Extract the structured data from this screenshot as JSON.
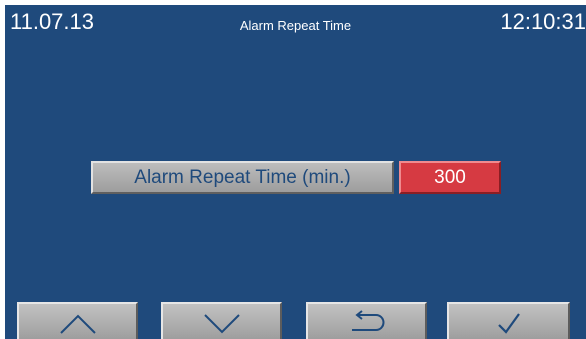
{
  "header": {
    "date": "11.07.13",
    "title": "Alarm Repeat Time",
    "time": "12:10:31"
  },
  "parameter": {
    "label": "Alarm Repeat Time (min.)",
    "value": "300"
  },
  "nav_buttons": [
    {
      "icon": "chevron-up-icon"
    },
    {
      "icon": "chevron-down-icon"
    },
    {
      "icon": "return-icon"
    },
    {
      "icon": "checkmark-icon"
    }
  ],
  "colors": {
    "background": "#1f4a7c",
    "value_field": "#d63a42",
    "button_gray": "#b0b0b0",
    "text_on_button": "#1f4a7c",
    "header_text": "#ffffff"
  }
}
